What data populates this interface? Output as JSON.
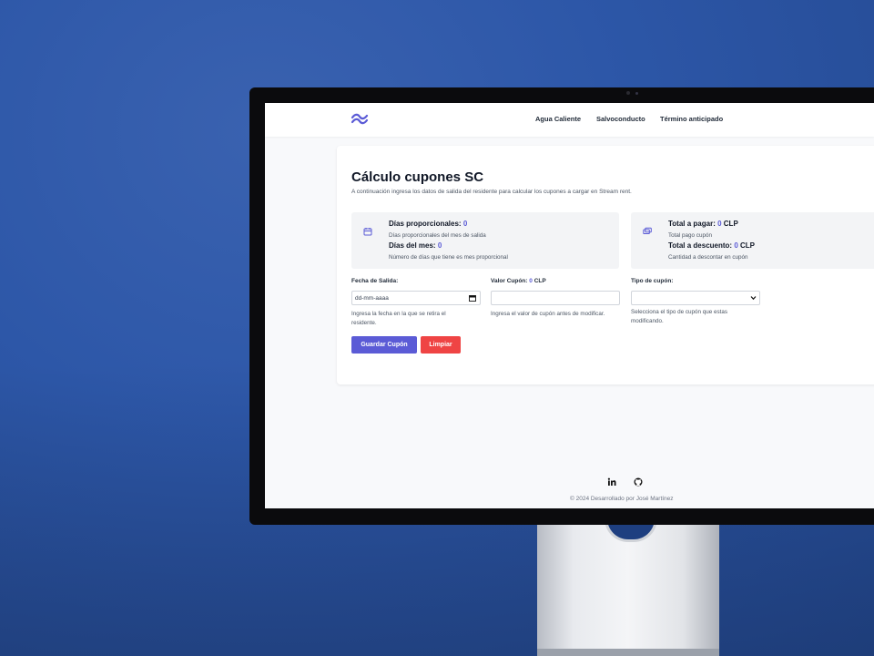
{
  "navbar": {
    "logo_icon": "tailwind-logo-icon",
    "items": [
      "Agua Caliente",
      "Salvoconducto",
      "Término anticipado"
    ]
  },
  "page": {
    "title": "Cálculo cupones SC",
    "subtitle": "A continuación ingresa los datos de salida del residente para calcular los cupones a cargar en Stream rent."
  },
  "stats_left": {
    "icon": "calendar-icon",
    "dias_proporcionales_label": "Días proporcionales:",
    "dias_proporcionales_value": "0",
    "dias_proporcionales_help": "Días proporcionales del mes de salida",
    "dias_mes_label": "Días del mes:",
    "dias_mes_value": "0",
    "dias_mes_help": "Número de días que tiene es mes proporcional"
  },
  "stats_right": {
    "icon": "money-icon",
    "total_pagar_label": "Total a pagar:",
    "total_pagar_value": "0",
    "total_pagar_unit": "CLP",
    "total_pagar_help": "Total pago cupón",
    "total_descuento_label": "Total a descuento:",
    "total_descuento_value": "0",
    "total_descuento_unit": "CLP",
    "total_descuento_help": "Cantidad a descontar en cupón"
  },
  "form": {
    "fecha_label": "Fecha de Salida:",
    "fecha_placeholder": "dd-mm-aaaa",
    "fecha_help": "Ingresa la fecha en la que se retira el residente.",
    "valor_label": "Valor Cupón:",
    "valor_value": "0",
    "valor_unit": "CLP",
    "valor_help": "Ingresa el valor de cupón antes de modificar.",
    "tipo_label": "Tipo de cupón:",
    "tipo_help": "Selecciona el tipo de cupón que estas modificando."
  },
  "buttons": {
    "save_label": "Guardar Cupón",
    "clear_label": "Limpiar",
    "save_color": "#5b5bd6",
    "clear_color": "#ef4444"
  },
  "footer": {
    "icons": [
      "linkedin-icon",
      "github-icon"
    ],
    "copyright": "© 2024 Desarrollado por José Martínez"
  }
}
